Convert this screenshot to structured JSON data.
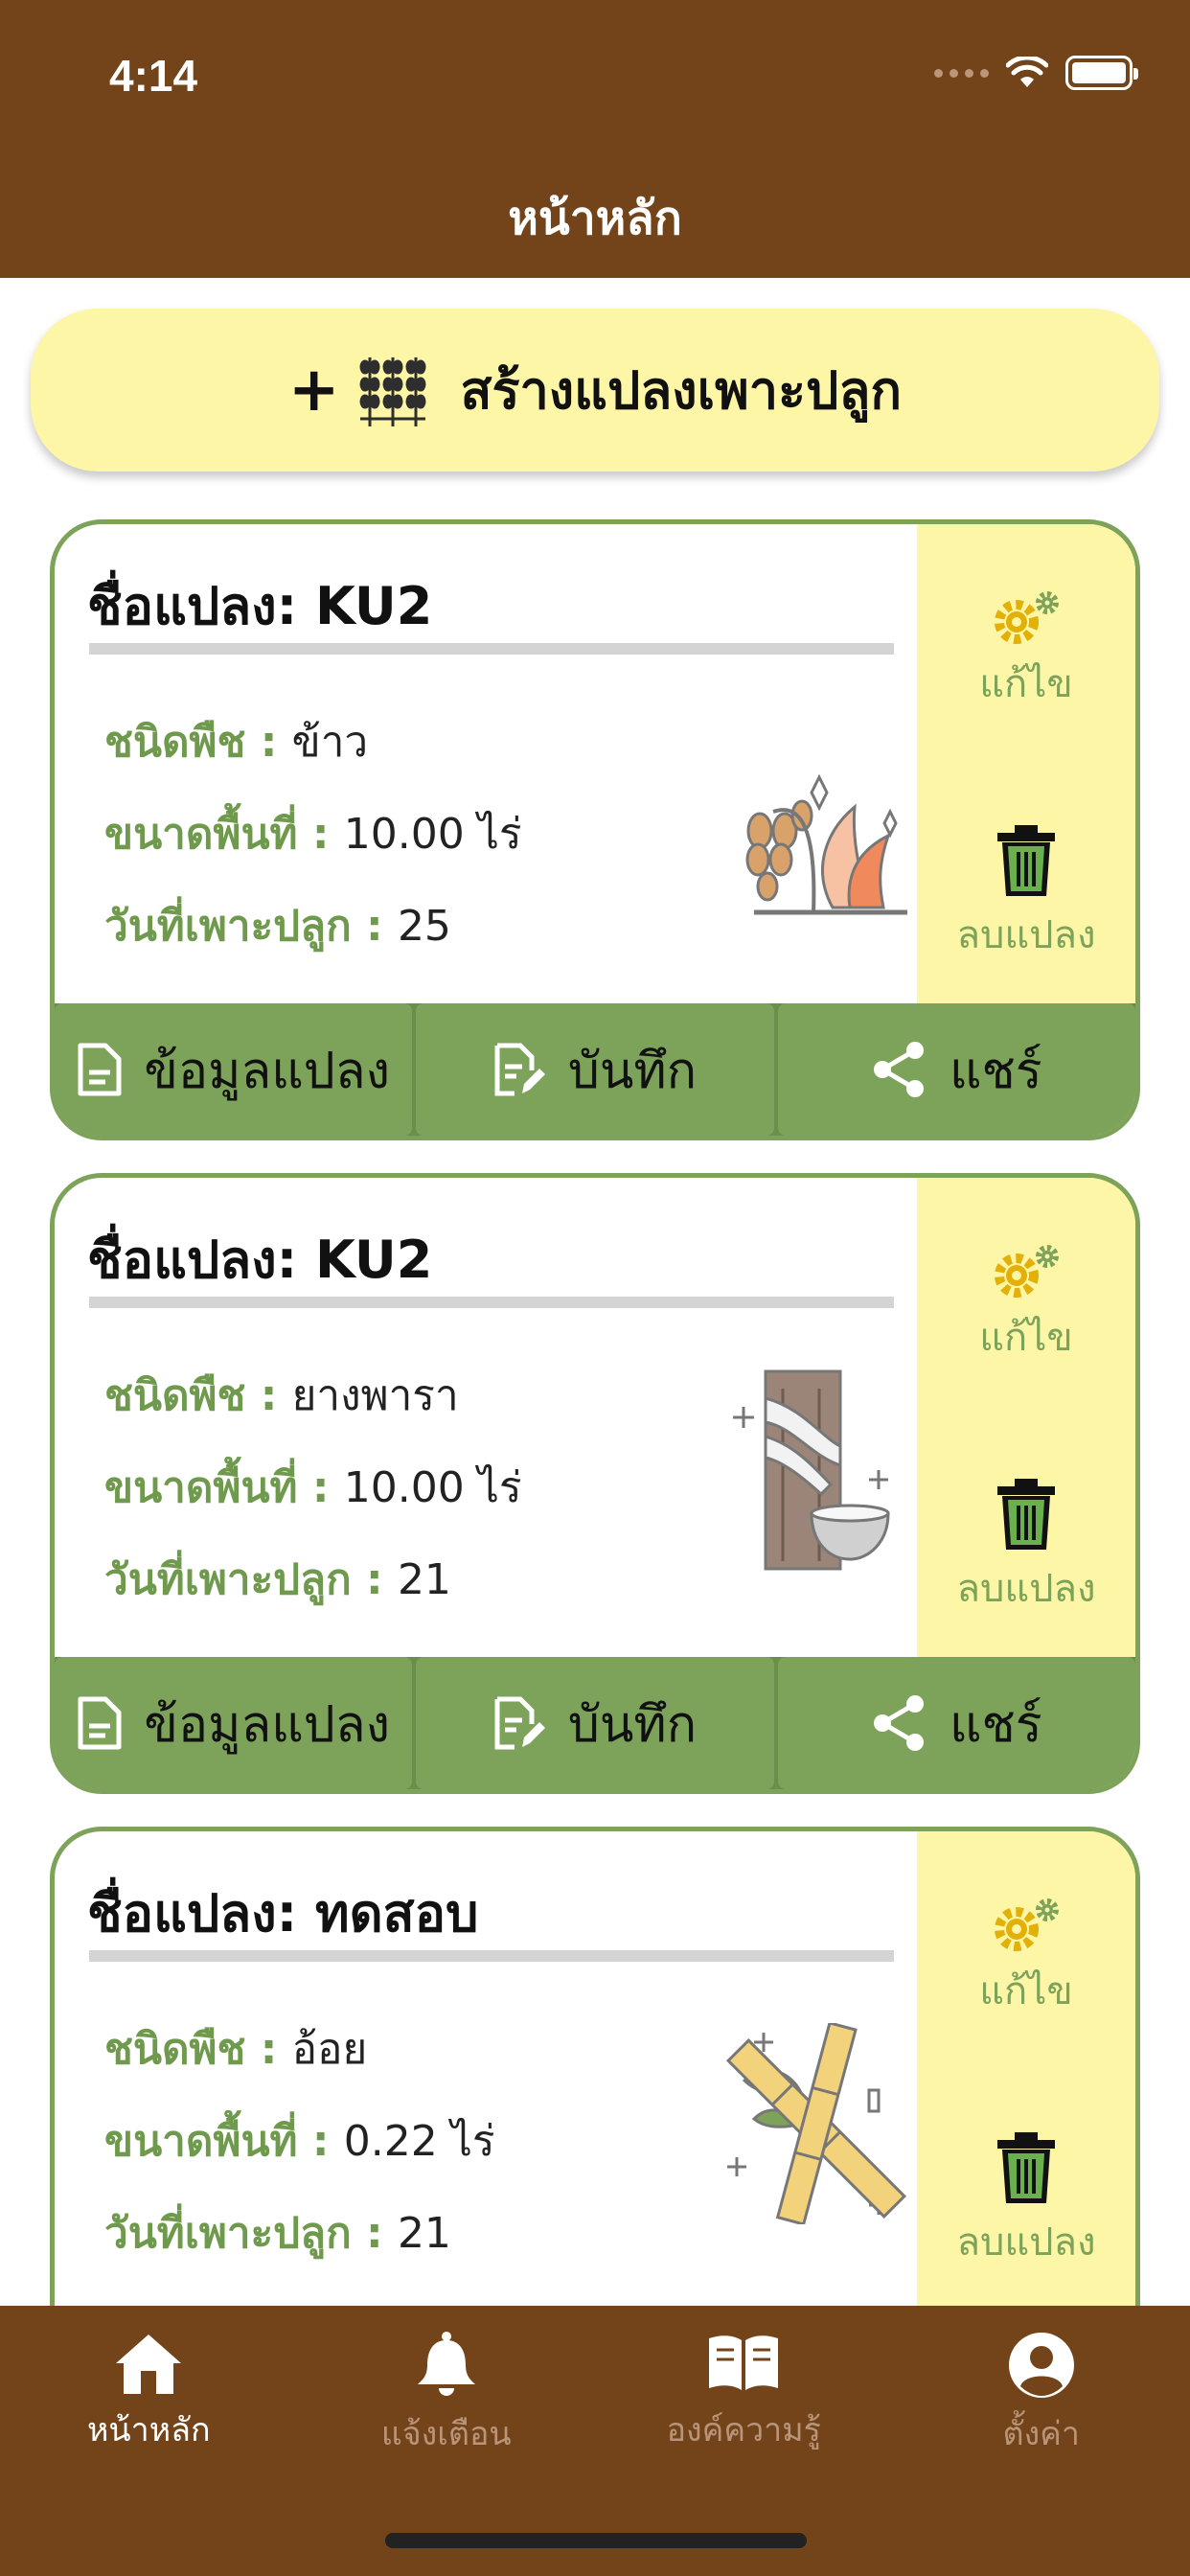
{
  "status_bar": {
    "time": "4:14"
  },
  "header": {
    "title": "หน้าหลัก"
  },
  "create_button": {
    "label": "สร้างแปลงเพาะปลูก",
    "icon": "wheat-plus-icon"
  },
  "labels": {
    "plant_type": "ชนิดพืช : ",
    "area": "ขนาดพื้นที่ : ",
    "planting_date": "วันที่เพาะปลูก : ",
    "edit": "แก้ไข",
    "delete": "ลบแปลง",
    "plot_info": "ข้อมูลแปลง",
    "record": "บันทึก",
    "share": "แชร์"
  },
  "plots": [
    {
      "name": "ชื่อแปลง: KU2",
      "plant": "ข้าว",
      "area": "10.00 ไร่",
      "date": "25",
      "icon": "rice-icon"
    },
    {
      "name": "ชื่อแปลง: KU2",
      "plant": "ยางพารา",
      "area": "10.00 ไร่",
      "date": "21",
      "icon": "rubber-tree-icon"
    },
    {
      "name": "ชื่อแปลง: ทดสอบ",
      "plant": "อ้อย",
      "area": "0.22 ไร่",
      "date": "21",
      "icon": "sugarcane-icon"
    }
  ],
  "tabbar": {
    "items": [
      {
        "label": "หน้าหลัก",
        "icon": "home-icon",
        "active": true
      },
      {
        "label": "แจ้งเตือน",
        "icon": "bell-icon",
        "active": false
      },
      {
        "label": "องค์ความรู้",
        "icon": "book-icon",
        "active": false
      },
      {
        "label": "ตั้งค่า",
        "icon": "user-circle-icon",
        "active": false
      }
    ]
  },
  "colors": {
    "header": "#734419",
    "accent_green": "#7da35b",
    "side_yellow": "#fdf6a6"
  }
}
